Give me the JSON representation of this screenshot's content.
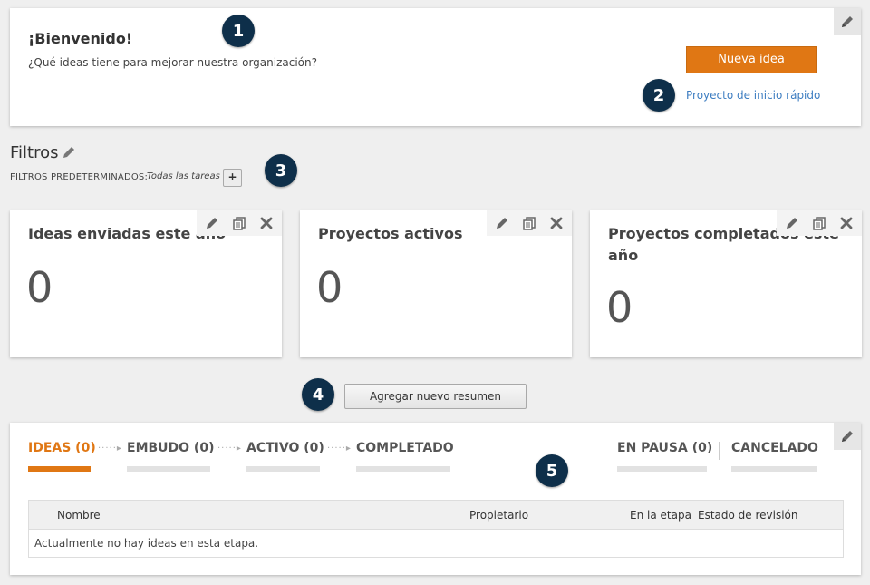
{
  "welcome": {
    "title": "¡Bienvenido!",
    "subtitle": "¿Qué ideas tiene para mejorar nuestra organización?",
    "new_idea_button": "Nueva idea",
    "quick_start_link": "Proyecto de inicio rápido"
  },
  "badges": [
    "1",
    "2",
    "3",
    "4",
    "5"
  ],
  "filters": {
    "title": "Filtros",
    "default_label": "FILTROS PREDETERMINADOS:",
    "default_value": "Todas las tareas",
    "add_label": "+"
  },
  "summaries": [
    {
      "title": "Ideas enviadas este año",
      "value": "0"
    },
    {
      "title": "Proyectos activos",
      "value": "0"
    },
    {
      "title": "Proyectos completados este año",
      "value": "0"
    }
  ],
  "add_summary_button": "Agregar nuevo resumen",
  "pipeline": {
    "stages": [
      {
        "label": "IDEAS (0)",
        "active": true
      },
      {
        "label": "EMBUDO (0)",
        "active": false
      },
      {
        "label": "ACTIVO (0)",
        "active": false
      },
      {
        "label": "COMPLETADO",
        "active": false
      },
      {
        "label": "EN PAUSA (0)",
        "active": false
      },
      {
        "label": "CANCELADO",
        "active": false
      }
    ],
    "arrow": "·····▸"
  },
  "table": {
    "columns": [
      "Nombre",
      "Propietario",
      "En la etapa",
      "Estado de revisión"
    ],
    "empty_message": "Actualmente no hay ideas en esta etapa."
  },
  "colors": {
    "accent": "#e07714",
    "link": "#3d7dc1",
    "badge": "#0e2f4a"
  },
  "icons": [
    "pencil-icon",
    "copy-icon",
    "close-icon"
  ]
}
